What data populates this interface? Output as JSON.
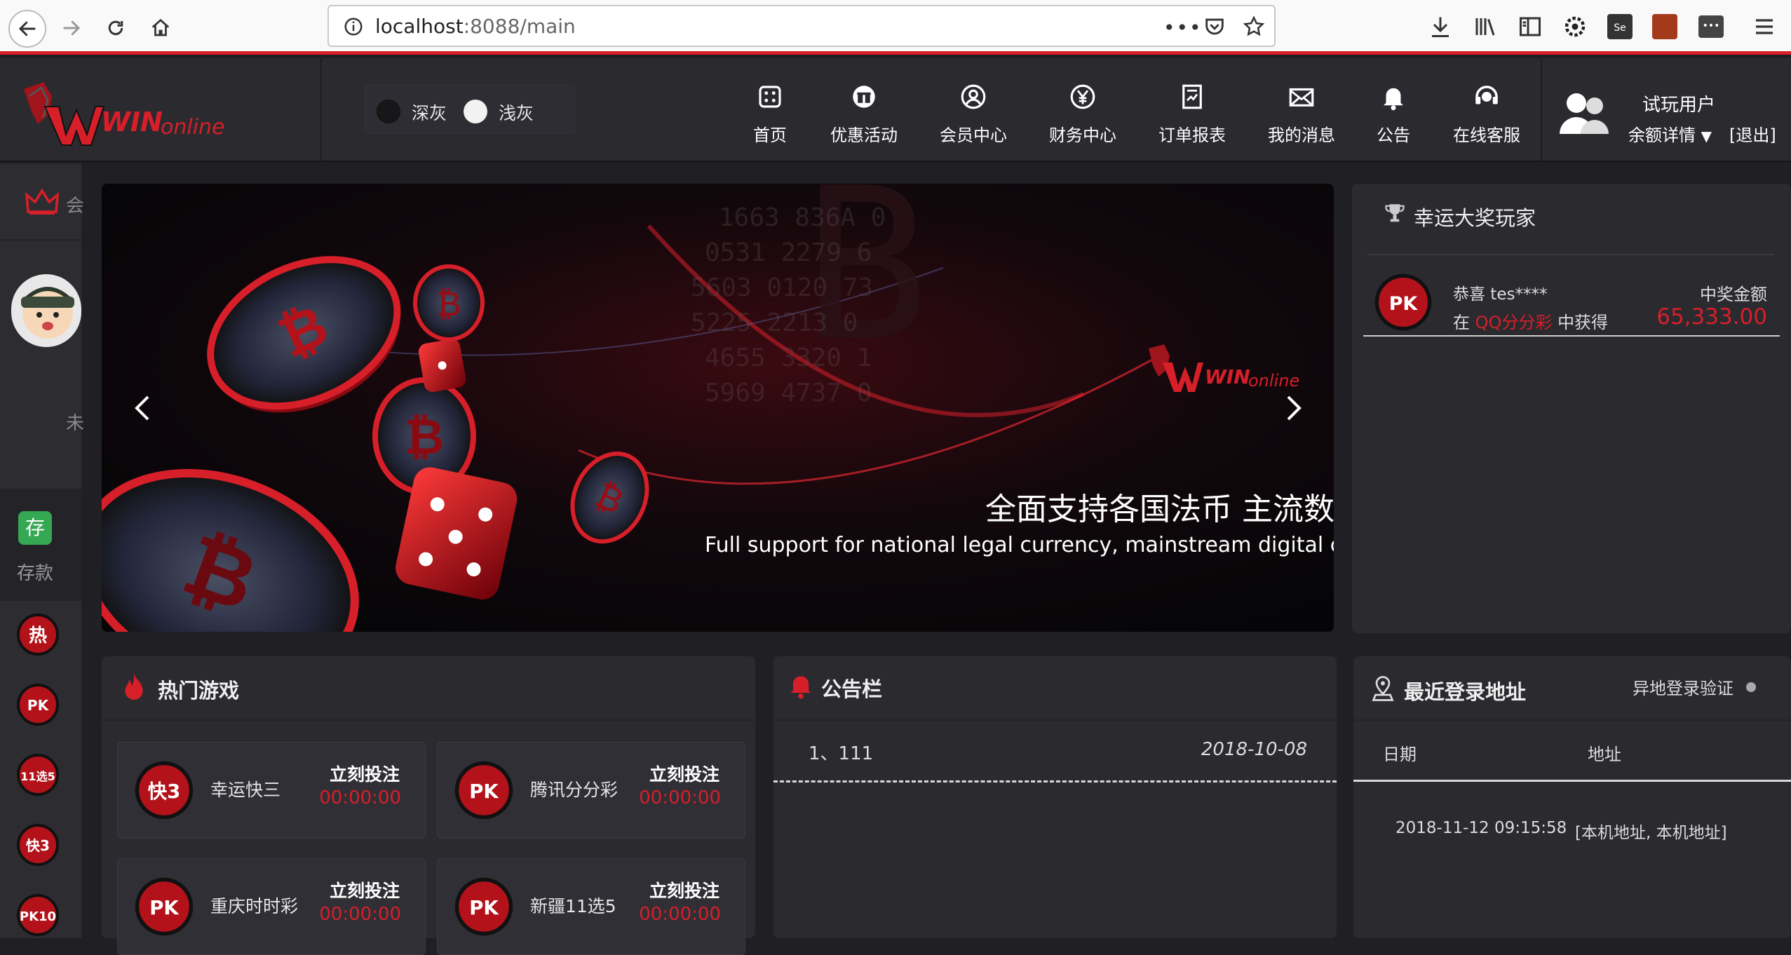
{
  "browser": {
    "url_host": "localhost",
    "url_rest": ":8088/main"
  },
  "theme": {
    "options": [
      {
        "label": "深灰",
        "color": "#1a1a1e"
      },
      {
        "label": "浅灰",
        "color": "#f2f2f2"
      }
    ]
  },
  "nav": [
    {
      "label": "首页",
      "icon": "home-grid-icon"
    },
    {
      "label": "优惠活动",
      "icon": "gift-icon"
    },
    {
      "label": "会员中心",
      "icon": "user-circle-icon"
    },
    {
      "label": "财务中心",
      "icon": "yen-coin-icon"
    },
    {
      "label": "订单报表",
      "icon": "report-icon"
    },
    {
      "label": "我的消息",
      "icon": "envelope-icon"
    },
    {
      "label": "公告",
      "icon": "bell-icon"
    },
    {
      "label": "在线客服",
      "icon": "headset-icon"
    }
  ],
  "user": {
    "name": "试玩用户",
    "balance_label": "余额详情",
    "exit_label": "[退出]"
  },
  "sidebar": {
    "member_label": "会",
    "status_label": "未",
    "deposit_badge": "存",
    "deposit_label": "存款",
    "game_icons": [
      "热",
      "PK",
      "11选5",
      "快3",
      "PK10"
    ]
  },
  "banner": {
    "logo_text": "WINonline",
    "headline": "全面支持各国法币  主流数字货币",
    "subline": "Full support for national legal currency, mainstream digital currency"
  },
  "winners": {
    "title": "幸运大奖玩家",
    "entries": [
      {
        "congrats": "恭喜 tes****",
        "prefix": "在",
        "game": "QQ分分彩",
        "suffix": "中获得",
        "amount_label": "中奖金额",
        "amount": "65,333.00"
      }
    ]
  },
  "hot_games": {
    "title": "热门游戏",
    "bet_label": "立刻投注",
    "items": [
      {
        "name": "幸运快三",
        "icon": "快3",
        "time": "00:00:00"
      },
      {
        "name": "腾讯分分彩",
        "icon": "PK",
        "time": "00:00:00"
      },
      {
        "name": "重庆时时彩",
        "icon": "PK",
        "time": "00:00:00"
      },
      {
        "name": "新疆11选5",
        "icon": "PK",
        "time": "00:00:00"
      }
    ]
  },
  "notice_board": {
    "title": "公告栏",
    "items": [
      {
        "text": "1、111",
        "date": "2018-10-08"
      }
    ]
  },
  "login_history": {
    "title": "最近登录地址",
    "verify_label": "异地登录验证",
    "col_date": "日期",
    "col_addr": "地址",
    "rows": [
      {
        "date": "2018-11-12 09:15:58",
        "addr": "[本机地址, 本机地址]"
      }
    ]
  },
  "colors": {
    "accent": "#d71f2a",
    "bg": "#1f1f24",
    "panel": "#2a2a2f",
    "win_green": "#34a853"
  }
}
